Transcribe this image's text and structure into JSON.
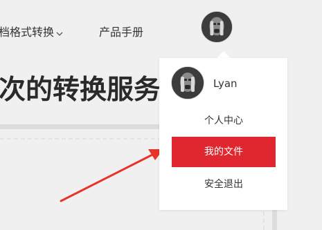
{
  "nav": {
    "doc_convert_label": "档格式转换",
    "manual_label": "产品手册"
  },
  "hero": {
    "title": "次的转换服务"
  },
  "user_menu": {
    "username": "Lyan",
    "items": [
      {
        "label": "个人中心"
      },
      {
        "label": "我的文件"
      },
      {
        "label": "安全退出"
      }
    ]
  },
  "colors": {
    "accent": "#e0262f",
    "page_bg": "#f0f0f0",
    "menu_bg": "#ffffff",
    "annotation_arrow": "#e8332a"
  },
  "icons": {
    "chevron": "chevron-down-icon",
    "avatar": "avatar",
    "annotation": "red-arrow"
  }
}
